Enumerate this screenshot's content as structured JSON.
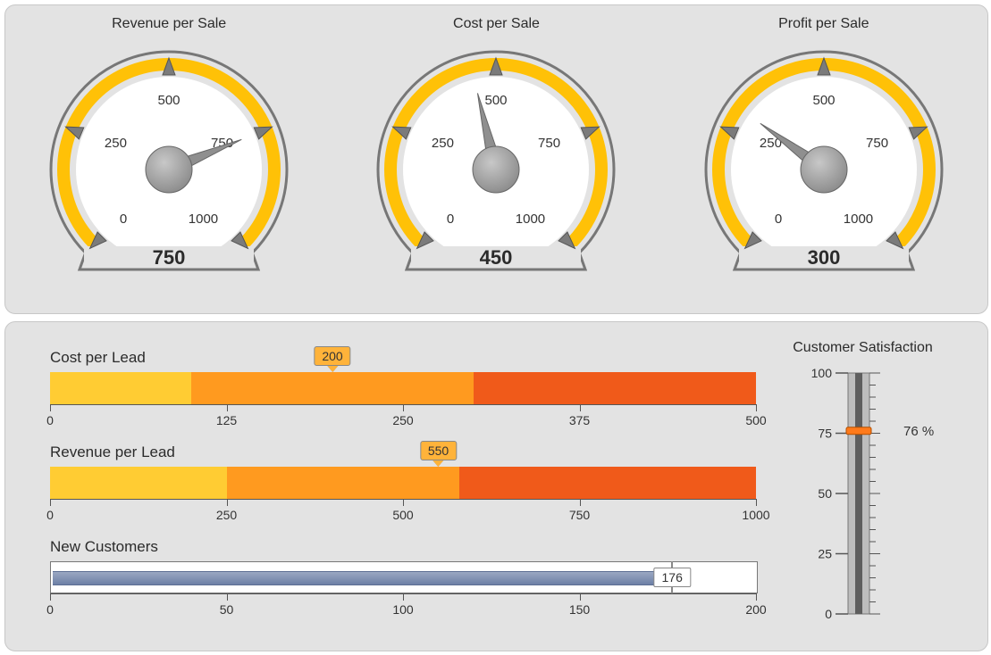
{
  "gauges": [
    {
      "title": "Revenue per Sale",
      "value": 750,
      "display": "750"
    },
    {
      "title": "Cost per Sale",
      "value": 450,
      "display": "450"
    },
    {
      "title": "Profit per Sale",
      "value": 300,
      "display": "300"
    }
  ],
  "gauge_scale": {
    "min": 0,
    "max": 1000,
    "ticks": [
      0,
      250,
      500,
      750,
      1000
    ],
    "labels": [
      "0",
      "250",
      "500",
      "750",
      "1000"
    ]
  },
  "bars": [
    {
      "title": "Cost per Lead",
      "type": "segmented",
      "min": 0,
      "max": 500,
      "ticks": [
        0,
        125,
        250,
        375,
        500
      ],
      "segments": [
        {
          "start": 0,
          "end": 100,
          "color": "#ffcc33"
        },
        {
          "start": 100,
          "end": 300,
          "color": "#ff9a1f"
        },
        {
          "start": 300,
          "end": 500,
          "color": "#f05a1a"
        }
      ],
      "value": 200,
      "display": "200"
    },
    {
      "title": "Revenue per Lead",
      "type": "segmented",
      "min": 0,
      "max": 1000,
      "ticks": [
        0,
        250,
        500,
        750,
        1000
      ],
      "segments": [
        {
          "start": 0,
          "end": 250,
          "color": "#ffcc33"
        },
        {
          "start": 250,
          "end": 580,
          "color": "#ff9a1f"
        },
        {
          "start": 580,
          "end": 1000,
          "color": "#f05a1a"
        }
      ],
      "value": 550,
      "display": "550"
    },
    {
      "title": "New Customers",
      "type": "line",
      "min": 0,
      "max": 200,
      "ticks": [
        0,
        50,
        100,
        150,
        200
      ],
      "value": 176,
      "display": "176"
    }
  ],
  "thermometer": {
    "title": "Customer Satisfaction",
    "min": 0,
    "max": 100,
    "ticks": [
      0,
      25,
      50,
      75,
      100
    ],
    "value": 76,
    "display": "76 %"
  },
  "chart_data": [
    {
      "type": "gauge",
      "title": "Revenue per Sale",
      "min": 0,
      "max": 1000,
      "ticks": [
        0,
        250,
        500,
        750,
        1000
      ],
      "value": 750
    },
    {
      "type": "gauge",
      "title": "Cost per Sale",
      "min": 0,
      "max": 1000,
      "ticks": [
        0,
        250,
        500,
        750,
        1000
      ],
      "value": 450
    },
    {
      "type": "gauge",
      "title": "Profit per Sale",
      "min": 0,
      "max": 1000,
      "ticks": [
        0,
        250,
        500,
        750,
        1000
      ],
      "value": 300
    },
    {
      "type": "bullet",
      "title": "Cost per Lead",
      "min": 0,
      "max": 500,
      "ticks": [
        0,
        125,
        250,
        375,
        500
      ],
      "value": 200,
      "bands": [
        {
          "from": 0,
          "to": 100
        },
        {
          "from": 100,
          "to": 300
        },
        {
          "from": 300,
          "to": 500
        }
      ]
    },
    {
      "type": "bullet",
      "title": "Revenue per Lead",
      "min": 0,
      "max": 1000,
      "ticks": [
        0,
        250,
        500,
        750,
        1000
      ],
      "value": 550,
      "bands": [
        {
          "from": 0,
          "to": 250
        },
        {
          "from": 250,
          "to": 580
        },
        {
          "from": 580,
          "to": 1000
        }
      ]
    },
    {
      "type": "bullet",
      "title": "New Customers",
      "min": 0,
      "max": 200,
      "ticks": [
        0,
        50,
        100,
        150,
        200
      ],
      "value": 176
    },
    {
      "type": "thermometer",
      "title": "Customer Satisfaction",
      "min": 0,
      "max": 100,
      "ticks": [
        0,
        25,
        50,
        75,
        100
      ],
      "value": 76,
      "unit": "%"
    }
  ]
}
